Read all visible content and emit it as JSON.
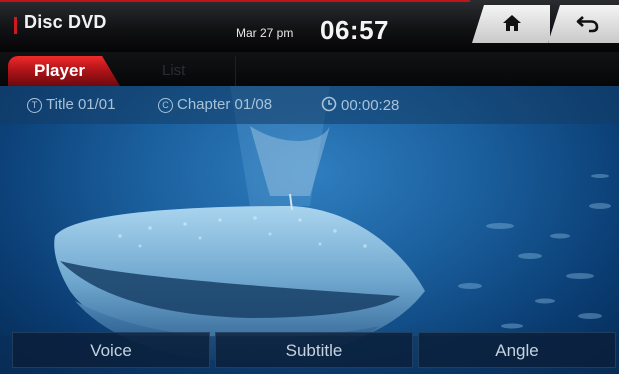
{
  "header": {
    "app_title": "Disc DVD",
    "date": "Mar 27 pm",
    "time": "06:57"
  },
  "nav": {
    "home_icon": "home-icon",
    "back_icon": "back-arrow-icon"
  },
  "tabs": [
    {
      "label": "Player",
      "active": true
    },
    {
      "label": "List",
      "active": false
    }
  ],
  "playback_info": {
    "title": "Title 01/01",
    "chapter": "Chapter 01/08",
    "elapsed": "00:00:28",
    "title_icon": "T",
    "chapter_icon": "C"
  },
  "controls": {
    "voice_label": "Voice",
    "subtitle_label": "Subtitle",
    "angle_label": "Angle"
  },
  "colors": {
    "accent": "#c0141b",
    "info_text": "#a8c2da"
  }
}
